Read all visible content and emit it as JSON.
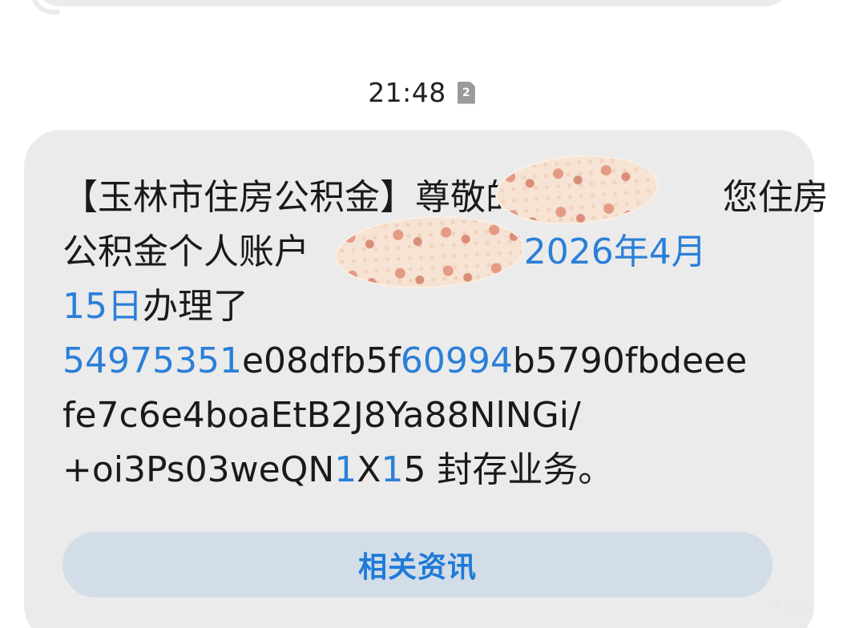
{
  "message_time": "21:48",
  "sim_slot": "2",
  "message": {
    "lines": [
      {
        "segments": [
          {
            "text": "【玉林市住房公积金】尊敬的",
            "link": false
          },
          {
            "text": "                  ",
            "link": false
          },
          {
            "text": "您住房",
            "link": false
          }
        ]
      },
      {
        "segments": [
          {
            "text": "公积金个人账户",
            "link": false
          },
          {
            "text": "                ",
            "link": false
          },
          {
            "text": "于",
            "link": false
          },
          {
            "text": "2026年4月",
            "link": true
          }
        ]
      },
      {
        "segments": [
          {
            "text": "15日",
            "link": true
          },
          {
            "text": "办理了",
            "link": false
          }
        ]
      },
      {
        "segments": [
          {
            "text": "54975351",
            "link": true
          },
          {
            "text": "e08dfb5f",
            "link": false
          },
          {
            "text": "60994",
            "link": true
          },
          {
            "text": "b5790fbdeee",
            "link": false
          }
        ]
      },
      {
        "segments": [
          {
            "text": "fe7c6e4boaEtB2J8Ya88NlNGi/",
            "link": false
          }
        ]
      },
      {
        "segments": [
          {
            "text": "+oi3Ps03weQN",
            "link": false
          },
          {
            "text": "1",
            "link": true
          },
          {
            "text": "X",
            "link": false
          },
          {
            "text": "1",
            "link": true
          },
          {
            "text": "5 封存业务。",
            "link": false
          }
        ]
      }
    ]
  },
  "related_info_button": "相关资讯",
  "watermark": "卡农社",
  "colors": {
    "bubble": "#ebebeb",
    "link": "#2a7fd8",
    "button_bg": "#d2dde8",
    "button_text": "#1f7ad8"
  }
}
